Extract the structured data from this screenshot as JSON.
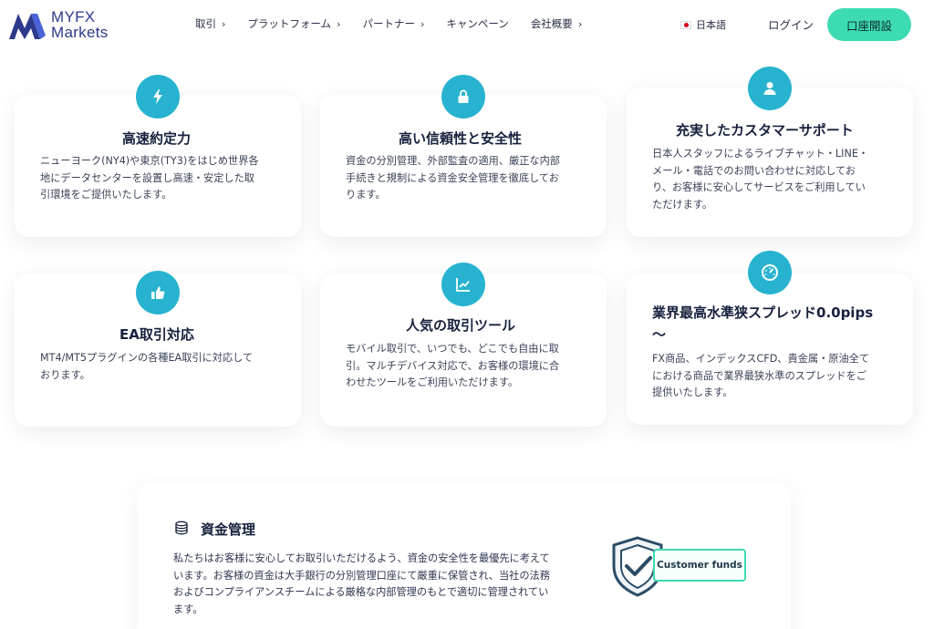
{
  "header": {
    "logo_line1": "MYFX",
    "logo_line2": "Markets",
    "nav": [
      {
        "label": "取引",
        "chevron": true
      },
      {
        "label": "プラットフォーム",
        "chevron": true
      },
      {
        "label": "パートナー",
        "chevron": true
      },
      {
        "label": "キャンペーン",
        "chevron": false
      },
      {
        "label": "会社概要",
        "chevron": true
      }
    ],
    "language": "日本語",
    "login": "ログイン",
    "open_account": "口座開設"
  },
  "features": [
    {
      "icon": "bolt-icon",
      "title": "高速約定力",
      "lines": [
        "ニューヨーク(NY4)や東京(TY3)をはじめ世界各",
        "地にデータセンターを設置し高速・安定した取",
        "引環境をご提供いたします。"
      ]
    },
    {
      "icon": "lock-icon",
      "title": "高い信頼性と安全性",
      "lines": [
        "資金の分別管理、外部監査の適用、厳正な内部",
        "手続きと規制による資金安全管理を徹底してお",
        "ります。"
      ]
    },
    {
      "icon": "user-icon",
      "title": "充実したカスタマーサポート",
      "lines": [
        "日本人スタッフによるライブチャット・LINE・",
        "メール・電話でのお問い合わせに対応してお",
        "り、お客様に安心してサービスをご利用してい",
        "ただけます。"
      ]
    },
    {
      "icon": "thumbs-up-icon",
      "title": "EA取引対応",
      "lines": [
        "MT4/MT5プラグインの各種EA取引に対応して",
        "おります。"
      ]
    },
    {
      "icon": "chart-line-icon",
      "title": "人気の取引ツール",
      "lines": [
        "モバイル取引で、いつでも、どこでも自由に取",
        "引。マルチデバイス対応で、お客様の環境に合",
        "わせたツールをご利用いただけます。"
      ]
    },
    {
      "icon": "speedometer-icon",
      "title_lines": [
        "業界最高水準狭スプレッド0.0pips",
        "〜"
      ],
      "lines": [
        "FX商品、インデックスCFD、貴金属・原油全て",
        "における商品で業界最狭水準のスプレッドをご",
        "提供いたします。"
      ]
    }
  ],
  "fund_section": {
    "title": "資金管理",
    "lines": [
      "私たちはお客様に安心してお取引いただけるよう、資金の安全性を最優先に考えて",
      "います。お客様の資金は大手銀行の分別管理口座にて厳重に保管され、当社の法務",
      "およびコンプライアンスチームによる厳格な内部管理のもとで適切に管理されてい",
      "ます。"
    ],
    "badge": "Customer funds"
  },
  "colors": {
    "accent": "#27b3cf",
    "cta": "#3ddbb2",
    "brand": "#2d3a8c"
  }
}
